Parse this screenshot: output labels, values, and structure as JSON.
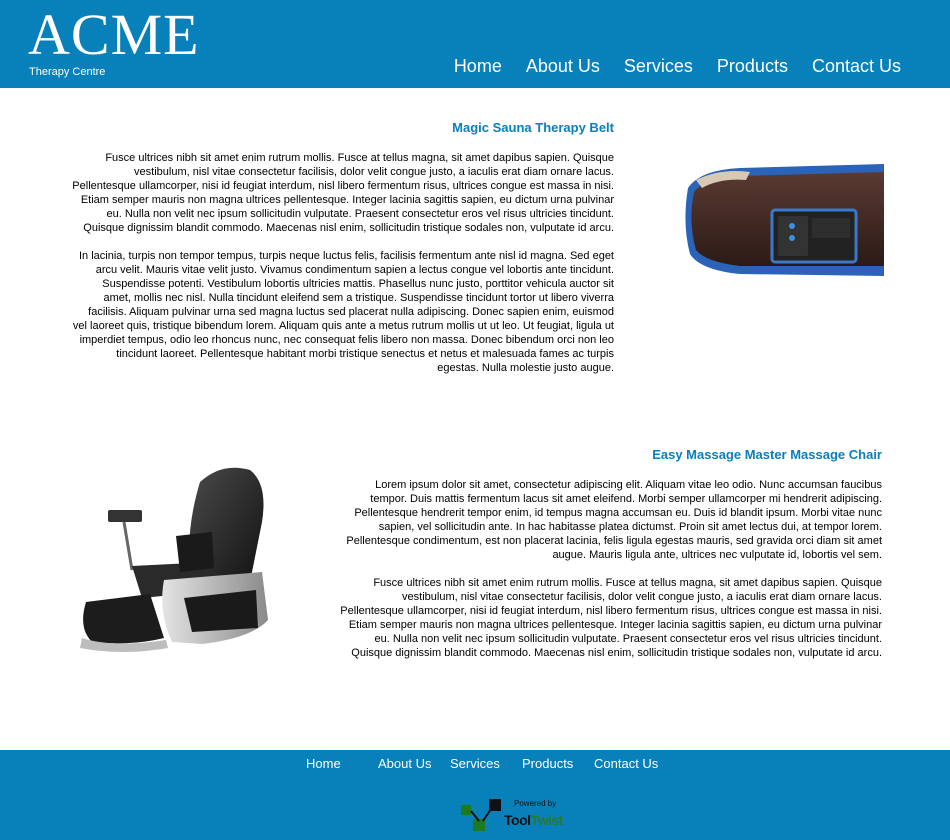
{
  "brand": {
    "name": "ACME",
    "tagline": "Therapy Centre"
  },
  "nav": [
    "Home",
    "About Us",
    "Services",
    "Products",
    "Contact Us"
  ],
  "products": [
    {
      "title": "Magic Sauna Therapy Belt",
      "paragraphs": [
        "Fusce ultrices nibh sit amet enim rutrum mollis. Fusce at tellus magna, sit amet dapibus sapien. Quisque vestibulum, nisl vitae consectetur facilisis, dolor velit congue justo, a iaculis erat diam ornare lacus. Pellentesque ullamcorper, nisi id feugiat interdum, nisl libero fermentum risus, ultrices congue est massa in nisi. Etiam semper mauris non magna ultrices pellentesque. Integer lacinia sagittis sapien, eu dictum urna pulvinar eu. Nulla non velit nec ipsum sollicitudin vulputate. Praesent consectetur eros vel risus ultricies tincidunt. Quisque dignissim blandit commodo. Maecenas nisl enim, sollicitudin tristique sodales non, vulputate id arcu.",
        "In lacinia, turpis non tempor tempus, turpis neque luctus felis, facilisis fermentum ante nisl id magna. Sed eget arcu velit. Mauris vitae velit justo. Vivamus condimentum sapien a lectus congue vel lobortis ante tincidunt. Suspendisse potenti. Vestibulum lobortis ultricies mattis. Phasellus nunc justo, porttitor vehicula auctor sit amet, mollis nec nisl. Nulla tincidunt eleifend sem a tristique. Suspendisse tincidunt tortor ut libero viverra facilisis. Aliquam pulvinar urna sed magna luctus sed placerat nulla adipiscing. Donec sapien enim, euismod vel laoreet quis, tristique bibendum lorem. Aliquam quis ante a metus rutrum mollis ut ut leo. Ut feugiat, ligula ut imperdiet tempus, odio leo rhoncus nunc, nec consequat felis libero non massa. Donec bibendum orci non leo tincidunt laoreet. Pellentesque habitant morbi tristique senectus et netus et malesuada fames ac turpis egestas. Nulla molestie justo augue."
      ]
    },
    {
      "title": "Easy Massage Master Massage Chair",
      "paragraphs": [
        "Lorem ipsum dolor sit amet, consectetur adipiscing elit. Aliquam vitae leo odio. Nunc accumsan faucibus tempor. Duis mattis fermentum lacus sit amet eleifend. Morbi semper ullamcorper mi hendrerit adipiscing. Pellentesque hendrerit tempor enim, id tempus magna accumsan eu. Duis id blandit ipsum. Morbi vitae nunc sapien, vel sollicitudin ante. In hac habitasse platea dictumst. Proin sit amet lectus dui, at tempor lorem. Pellentesque condimentum, est non placerat lacinia, felis ligula egestas mauris, sed gravida orci diam sit amet augue. Mauris ligula ante, ultrices nec vulputate id, lobortis vel sem.",
        "Fusce ultrices nibh sit amet enim rutrum mollis. Fusce at tellus magna, sit amet dapibus sapien. Quisque vestibulum, nisl vitae consectetur facilisis, dolor velit congue justo, a iaculis erat diam ornare lacus. Pellentesque ullamcorper, nisi id feugiat interdum, nisl libero fermentum risus, ultrices congue est massa in nisi. Etiam semper mauris non magna ultrices pellentesque. Integer lacinia sagittis sapien, eu dictum urna pulvinar eu. Nulla non velit nec ipsum sollicitudin vulputate. Praesent consectetur eros vel risus ultricies tincidunt. Quisque dignissim blandit commodo. Maecenas nisl enim, sollicitudin tristique sodales non, vulputate id arcu."
      ]
    }
  ],
  "footer": {
    "nav": [
      "Home",
      "About Us",
      "Services",
      "Products",
      "Contact Us"
    ],
    "powered_by": "Powered by",
    "brand_tool": "Tool",
    "brand_twist": "Twist"
  },
  "colors": {
    "brand_blue": "#0880ba",
    "footer_logo_green": "#2a7a2a"
  },
  "icons": [
    "sauna-belt-image",
    "massage-chair-image",
    "tooltwist-logo-icon"
  ]
}
